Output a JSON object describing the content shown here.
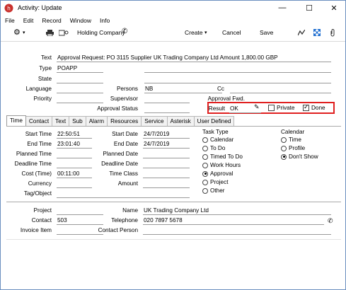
{
  "window": {
    "title": "Activity: Update",
    "colors": {
      "red_box": "#e02020",
      "accent": "#1f6fd1"
    }
  },
  "menu": [
    "File",
    "Edit",
    "Record",
    "Window",
    "Info"
  ],
  "toolbar": {
    "company": "Holding Company",
    "create": "Create",
    "cancel": "Cancel",
    "save": "Save"
  },
  "header": {
    "text_label": "Text",
    "text_value": "Approval Request: PO 3115 Supplier UK Trading Company Ltd Amount 1,800.00 GBP",
    "type_label": "Type",
    "type_value": "POAPP",
    "state_label": "State",
    "language_label": "Language",
    "persons_label": "Persons",
    "persons_value": "NB",
    "cc_label": "Cc",
    "priority_label": "Priority",
    "supervisor_label": "Supervisor",
    "approval_fwd_label": "Approval Fwd.",
    "approval_status_label": "Approval Status",
    "result_label": "Result",
    "result_value": "OK",
    "private_label": "Private",
    "private_checked": false,
    "done_label": "Done",
    "done_checked": true
  },
  "tabs": [
    "Time",
    "Contact",
    "Text",
    "Sub",
    "Alarm",
    "Resources",
    "Service",
    "Asterisk",
    "User Defined"
  ],
  "time": {
    "start_time_label": "Start Time",
    "start_time_value": "22:50:51",
    "end_time_label": "End Time",
    "end_time_value": "23:01:40",
    "planned_time_label": "Planned Time",
    "deadline_time_label": "Deadline Time",
    "cost_time_label": "Cost (Time)",
    "cost_time_value": "00:11:00",
    "currency_label": "Currency",
    "tag_label": "Tag/Object",
    "start_date_label": "Start Date",
    "start_date_value": "24/7/2019",
    "end_date_label": "End Date",
    "end_date_value": "24/7/2019",
    "planned_date_label": "Planned Date",
    "deadline_date_label": "Deadline Date",
    "time_class_label": "Time Class",
    "amount_label": "Amount"
  },
  "task_type": {
    "label": "Task Type",
    "options": [
      "Calendar",
      "To Do",
      "Timed To Do",
      "Work Hours",
      "Approval",
      "Project",
      "Other"
    ],
    "selected": "Approval"
  },
  "calendar": {
    "label": "Calendar",
    "options": [
      "Time",
      "Profile",
      "Don't Show"
    ],
    "selected": "Don't Show"
  },
  "bottom": {
    "project_label": "Project",
    "contact_label": "Contact",
    "contact_value": "503",
    "invoice_item_label": "Invoice Item",
    "name_label": "Name",
    "name_value": "UK Trading Company Ltd",
    "telephone_label": "Telephone",
    "telephone_value": "020 7897 5678",
    "contact_person_label": "Contact Person"
  }
}
